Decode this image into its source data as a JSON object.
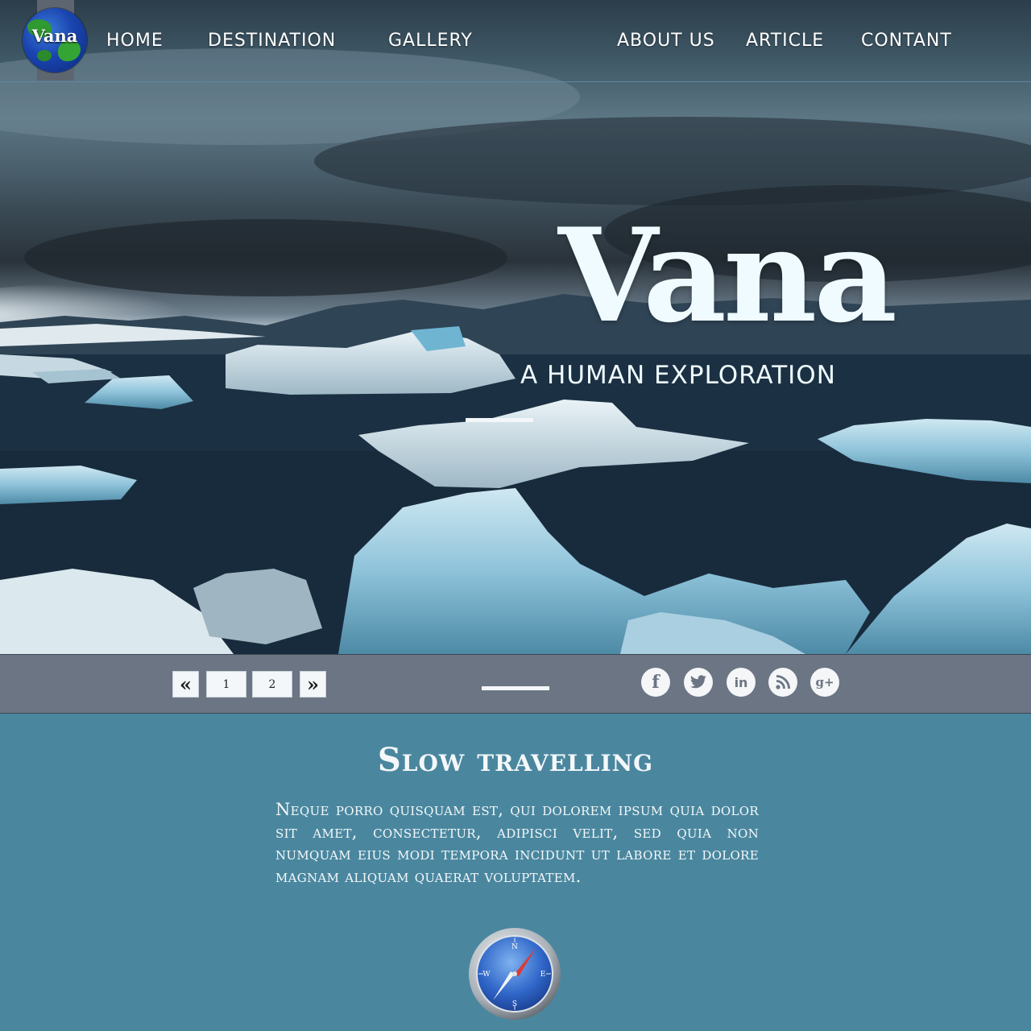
{
  "brand": {
    "logo_text": "Vana"
  },
  "nav": {
    "items": [
      {
        "label": "HOME"
      },
      {
        "label": "DESTINATION"
      },
      {
        "label": "GALLERY"
      },
      {
        "label": "ABOUT US"
      },
      {
        "label": "ARTICLE"
      },
      {
        "label": "CONTANT"
      }
    ]
  },
  "hero": {
    "title": "Vana",
    "subtitle": "A HUMAN EXPLORATION"
  },
  "pagination": {
    "prev_icon": "double-chevron-left-icon",
    "next_icon": "double-chevron-right-icon",
    "prev_glyph": "«",
    "next_glyph": "»",
    "pages": [
      "1",
      "2"
    ]
  },
  "social": [
    {
      "icon": "facebook-icon",
      "glyph": "f"
    },
    {
      "icon": "twitter-icon",
      "glyph": "t"
    },
    {
      "icon": "linkedin-icon",
      "glyph": "in"
    },
    {
      "icon": "rss-icon",
      "glyph": "◉"
    },
    {
      "icon": "google-plus-icon",
      "glyph": "g+"
    }
  ],
  "section": {
    "title": "Slow travelling",
    "body": "Neque porro quisquam est, qui dolorem ipsum quia dolor sit amet, consectetur, adipisci velit, sed quia non numquam eius modi tempora incidunt ut labore et dolore magnam aliquam quaerat voluptatem."
  },
  "colors": {
    "content_bg": "#4a879f",
    "bar_bg": "#6b7584",
    "hero_text": "#effbff"
  }
}
